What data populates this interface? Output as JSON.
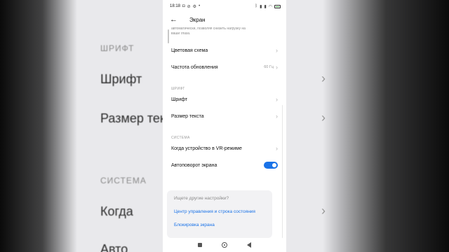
{
  "status_bar": {
    "time": "18:18",
    "battery_level": 0.3,
    "accent_battery_color": "#4caf50"
  },
  "header": {
    "back_icon": "←",
    "title": "Экран"
  },
  "intro_text": "автоматически, позволяя снизить нагрузку на ваши глаза.",
  "rows_top": [
    {
      "label": "Цветовая схема",
      "value": ""
    },
    {
      "label": "Частота обновления",
      "value": "60 Гц"
    }
  ],
  "section_font": {
    "label": "ШРИФТ",
    "rows": [
      {
        "label": "Шрифт"
      },
      {
        "label": "Размер текста"
      }
    ]
  },
  "section_system": {
    "label": "СИСТЕМА",
    "rows": [
      {
        "label": "Когда устройство в VR-режиме"
      },
      {
        "label": "Автоповорот экрана",
        "toggle_on": true
      }
    ]
  },
  "suggestions": {
    "title": "Ищете другие настройки?",
    "links": [
      "Центр управления и строка состояния",
      "Блокировка экрана"
    ]
  },
  "colors": {
    "accent": "#1a73e8"
  },
  "backdrop": {
    "left_section": "ШРИФТ",
    "left_rows": [
      "Шрифт",
      "Размер текста"
    ],
    "left_section2": "СИСТЕМА",
    "left_rows2": [
      "Когда",
      "Авто"
    ]
  }
}
